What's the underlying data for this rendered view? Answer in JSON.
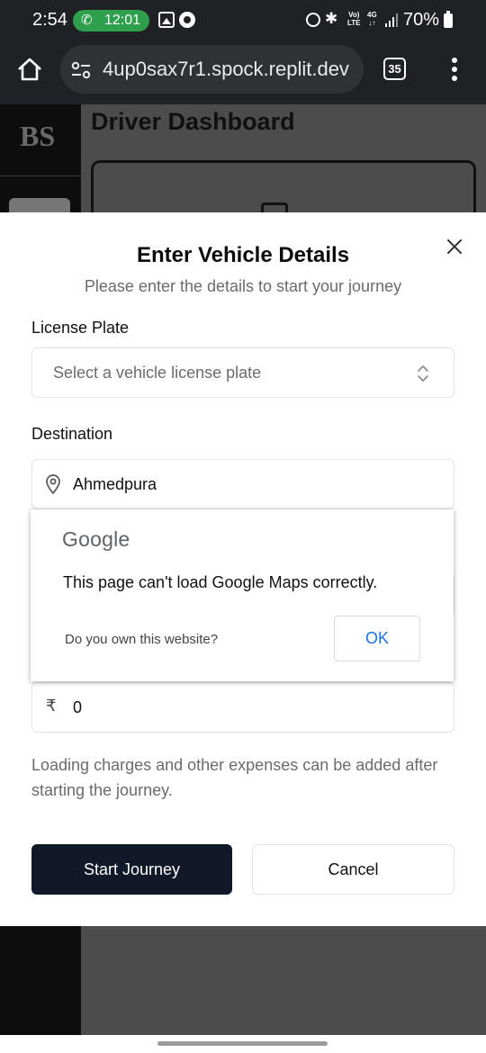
{
  "status_bar": {
    "time": "2:54",
    "call_time": "12:01",
    "battery": "70%",
    "volte_top": "Vo)",
    "volte_bottom": "LTE",
    "net_top": "4G",
    "net_bottom": "↓↑"
  },
  "browser": {
    "url": "4up0sax7r1.spock.replit.dev",
    "tab_count": "35"
  },
  "background_page": {
    "logo": "BS",
    "heading": "Driver Dashboard"
  },
  "modal": {
    "title": "Enter Vehicle Details",
    "subtitle": "Please enter the details to start your journey",
    "license_label": "License Plate",
    "license_placeholder": "Select a vehicle license plate",
    "destination_label": "Destination",
    "destination_value": "Ahmedpura",
    "amount_currency": "₹",
    "amount_value": "0",
    "help_text": "Loading charges and other expenses can be added after starting the journey.",
    "start_button": "Start Journey",
    "cancel_button": "Cancel"
  },
  "gmaps_error": {
    "logo": "Google",
    "message": "This page can't load Google Maps correctly.",
    "question": "Do you own this website?",
    "ok_button": "OK"
  },
  "colors": {
    "call_pill": "#2e9f4c",
    "primary_button": "#111827",
    "google_blue": "#1a73e8"
  }
}
